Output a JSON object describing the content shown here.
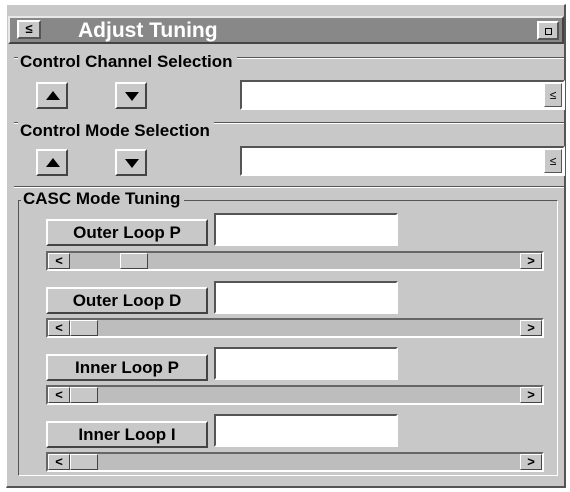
{
  "window": {
    "title": "Adjust Tuning",
    "menu_glyph": "≤",
    "min_glyph": ""
  },
  "control_channel": {
    "label": "Control Channel Selection",
    "value": "",
    "dropdown_glyph": "≤"
  },
  "control_mode": {
    "label": "Control Mode Selection",
    "value": "",
    "dropdown_glyph": "≤"
  },
  "casc": {
    "label": "CASC Mode Tuning",
    "params": [
      {
        "label": "Outer Loop P",
        "value": "",
        "slider_position": 0.12
      },
      {
        "label": "Outer Loop D",
        "value": "",
        "slider_position": 0.0
      },
      {
        "label": "Inner Loop P",
        "value": "",
        "slider_position": 0.0
      },
      {
        "label": "Inner Loop I",
        "value": "",
        "slider_position": 0.0
      }
    ]
  },
  "scroll": {
    "left_glyph": "<",
    "right_glyph": ">"
  },
  "colors": {
    "titlebar": "#888888",
    "panel": "#c8c8c8",
    "field": "#ffffff"
  }
}
